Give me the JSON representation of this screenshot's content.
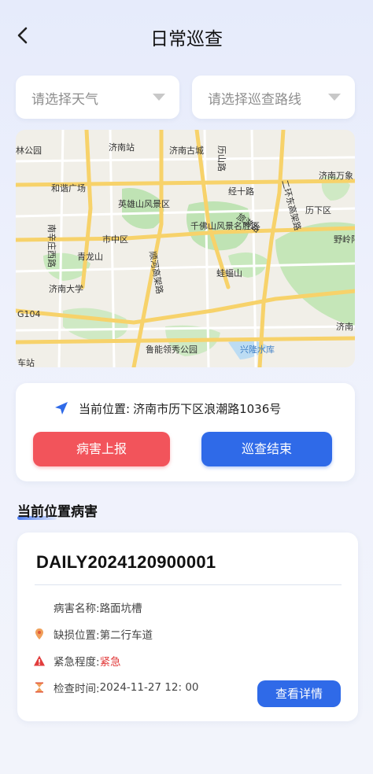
{
  "header": {
    "title": "日常巡查"
  },
  "filters": {
    "weather_placeholder": "请选择天气",
    "route_placeholder": "请选择巡查路线"
  },
  "map": {
    "labels": {
      "l1": "济南站",
      "l2": "济南古城",
      "l3": "历山路",
      "l4": "济南万象",
      "l5": "林公园",
      "l6": "和谐广场",
      "l7": "经十路",
      "l8": "英雄山风景区",
      "l9": "二环东高架路",
      "l10": "历下区",
      "l11": "南辛庄西路",
      "l12": "市中区",
      "l13": "千佛山风景名胜区",
      "l14": "旅游路",
      "l15": "野岭阳",
      "l16": "青龙山",
      "l17": "顺河高架路",
      "l18": "蛙蝠山",
      "l19": "济南大学",
      "l20": "G104",
      "l21": "济南",
      "l22": "鲁能领秀公园",
      "l23": "兴隆水库",
      "l24": "车站"
    }
  },
  "location": {
    "label": "当前位置:",
    "value": "济南市历下区浪潮路1036号"
  },
  "actions": {
    "report_label": "病害上报",
    "finish_label": "巡查结束"
  },
  "section": {
    "title": "当前位置病害"
  },
  "disease": {
    "id": "DAILY2024120900001",
    "name_label": "病害名称:",
    "name_value": "路面坑槽",
    "position_label": "缺损位置:",
    "position_value": "第二行车道",
    "urgency_label": "紧急程度:",
    "urgency_value": "紧急",
    "time_label": "检查时间:",
    "time_value": "2024-11-27 12: 00",
    "detail_label": "查看详情"
  },
  "colors": {
    "accent": "#2f6ae8",
    "danger": "#f2545b",
    "urgent_text": "#e23d3d"
  },
  "icons": {
    "back": "chevron-left-icon",
    "caret": "caret-down-icon",
    "location": "navigation-arrow-icon",
    "position": "map-pin-icon",
    "urgency": "warning-triangle-icon",
    "time": "hourglass-icon"
  }
}
